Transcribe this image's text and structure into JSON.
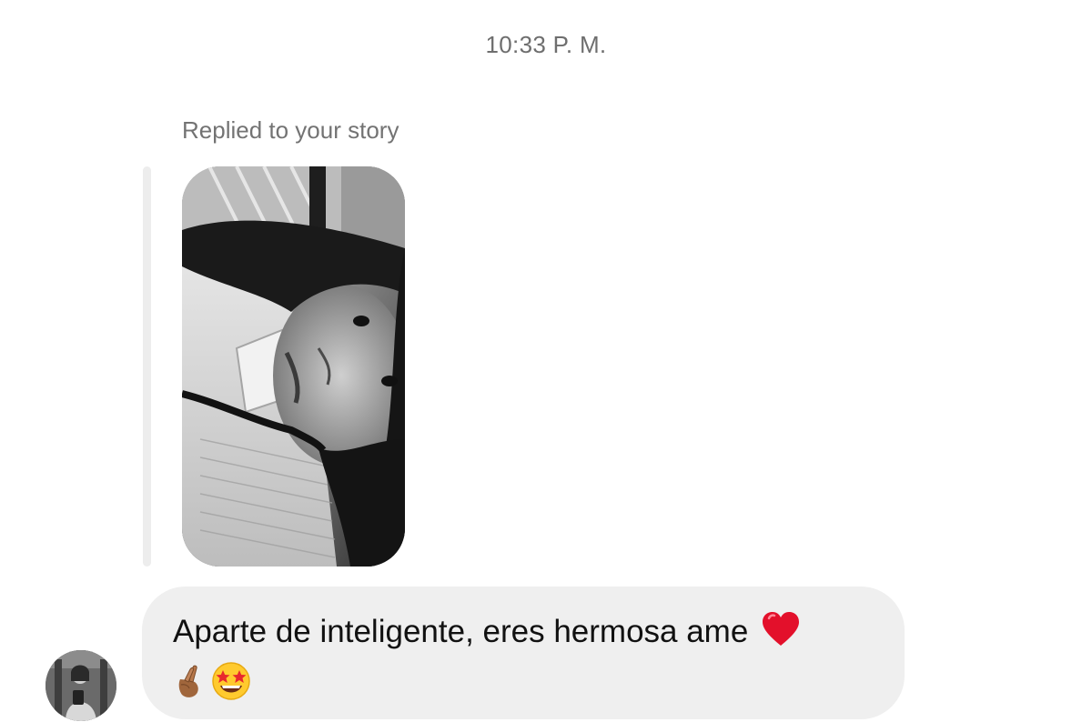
{
  "thread": {
    "timestamp": "10:33 P. M.",
    "reply_context": "Replied to your story",
    "story_thumbnail_icon": "story-photo",
    "sender_avatar_icon": "profile-photo",
    "message": {
      "text": "Aparte de inteligente, eres hermosa ame",
      "emojis": [
        "red-heart",
        "hand-with-index-finger-and-thumb-crossed",
        "star-struck"
      ]
    }
  },
  "colors": {
    "background": "#ffffff",
    "bubble": "#efefef",
    "reply_bar": "#ededed",
    "muted_text": "#737373",
    "message_text": "#111111",
    "heart": "#e3102b"
  }
}
